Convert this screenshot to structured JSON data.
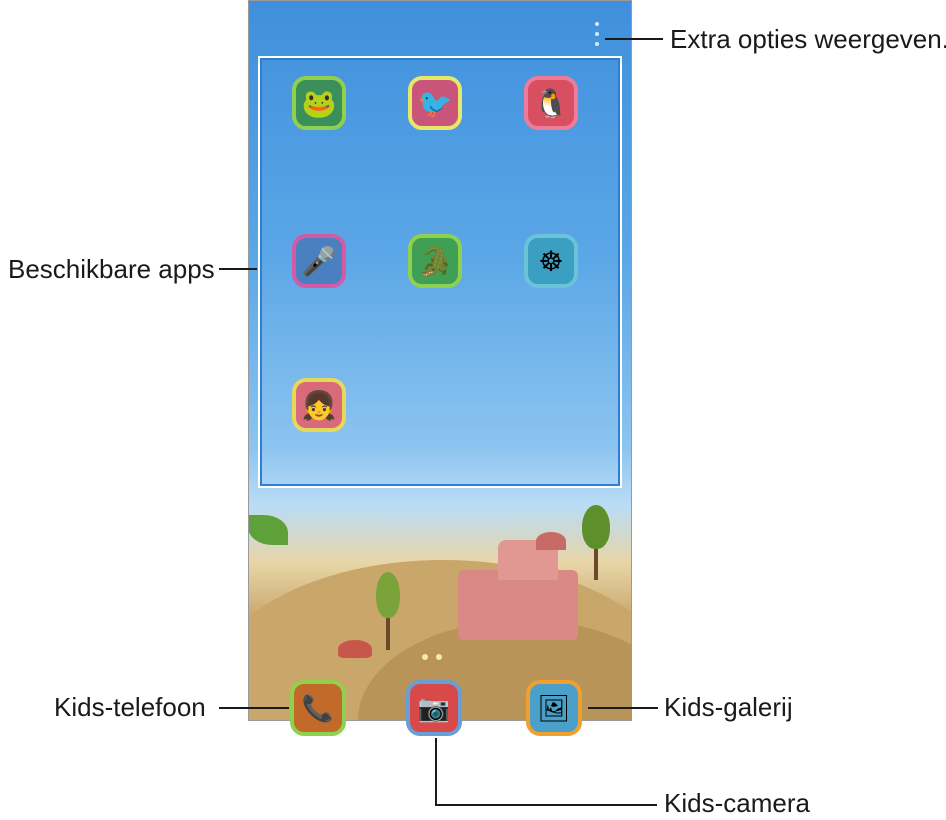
{
  "callouts": {
    "extra_options": "Extra opties weergeven.",
    "available_apps": "Beschikbare apps",
    "kids_phone": "Kids-telefoon",
    "kids_gallery": "Kids-galerij",
    "kids_camera": "Kids-camera"
  },
  "apps": [
    {
      "label": "",
      "icon": "frog-character-icon",
      "glyph": "🐸",
      "border": "#8fd14f",
      "bg": "#3a8f5a"
    },
    {
      "label": "",
      "icon": "bird-character-icon",
      "glyph": "🐦",
      "border": "#e6e86a",
      "bg": "#c9567a"
    },
    {
      "label": "",
      "icon": "penguin-character-icon",
      "glyph": "🐧",
      "border": "#f07a9a",
      "bg": "#d85060"
    },
    {
      "label": "",
      "icon": "microphone-icon",
      "glyph": "🎤",
      "border": "#d45aa8",
      "bg": "#4a7fc0"
    },
    {
      "label": "",
      "icon": "crocodile-character-icon",
      "glyph": "🐊",
      "border": "#8fd14f",
      "bg": "#3f9f55"
    },
    {
      "label": "",
      "icon": "ship-wheel-icon",
      "glyph": "☸",
      "border": "#6ac3d8",
      "bg": "#3a9fc0"
    },
    {
      "label": "",
      "icon": "girl-character-icon",
      "glyph": "👧",
      "border": "#e6d85a",
      "bg": "#d86a7a"
    }
  ],
  "dock": [
    {
      "label": "",
      "icon": "phone-icon",
      "glyph": "📞",
      "border": "#8fd14f",
      "bg": "#c26a2a"
    },
    {
      "label": "",
      "icon": "camera-icon",
      "glyph": "📷",
      "border": "#6a9ed8",
      "bg": "#d84a4a"
    },
    {
      "label": "",
      "icon": "gallery-icon",
      "glyph": "🖼",
      "border": "#f0a030",
      "bg": "#4aa0c8"
    }
  ]
}
